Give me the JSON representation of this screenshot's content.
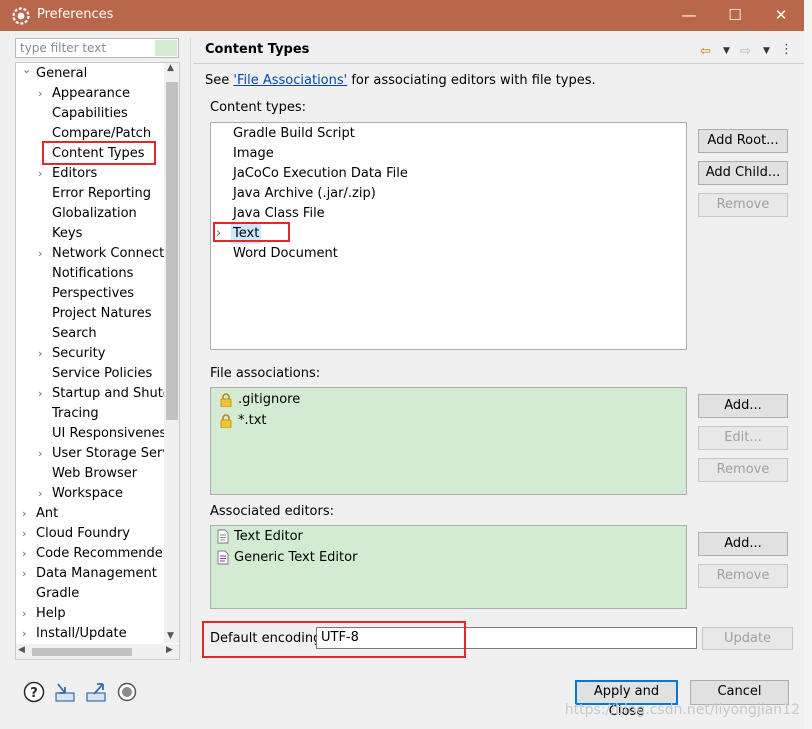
{
  "window": {
    "title": "Preferences",
    "minimize": "—",
    "maximize": "☐",
    "close": "✕"
  },
  "filter": {
    "placeholder": "type filter text"
  },
  "tree": {
    "items": [
      {
        "label": "General",
        "level": 0,
        "expanded": true
      },
      {
        "label": "Appearance",
        "level": 1,
        "arrow": true
      },
      {
        "label": "Capabilities",
        "level": 1
      },
      {
        "label": "Compare/Patch",
        "level": 1
      },
      {
        "label": "Content Types",
        "level": 1,
        "selected": true
      },
      {
        "label": "Editors",
        "level": 1,
        "arrow": true
      },
      {
        "label": "Error Reporting",
        "level": 1
      },
      {
        "label": "Globalization",
        "level": 1
      },
      {
        "label": "Keys",
        "level": 1
      },
      {
        "label": "Network Connectio",
        "level": 1,
        "arrow": true
      },
      {
        "label": "Notifications",
        "level": 1
      },
      {
        "label": "Perspectives",
        "level": 1
      },
      {
        "label": "Project Natures",
        "level": 1
      },
      {
        "label": "Search",
        "level": 1
      },
      {
        "label": "Security",
        "level": 1,
        "arrow": true
      },
      {
        "label": "Service Policies",
        "level": 1
      },
      {
        "label": "Startup and Shutdo",
        "level": 1,
        "arrow": true
      },
      {
        "label": "Tracing",
        "level": 1
      },
      {
        "label": "UI Responsiveness",
        "level": 1
      },
      {
        "label": "User Storage Servic",
        "level": 1,
        "arrow": true
      },
      {
        "label": "Web Browser",
        "level": 1
      },
      {
        "label": "Workspace",
        "level": 1,
        "arrow": true
      },
      {
        "label": "Ant",
        "level": 0,
        "arrow": true
      },
      {
        "label": "Cloud Foundry",
        "level": 0,
        "arrow": true
      },
      {
        "label": "Code Recommenders",
        "level": 0,
        "arrow": true
      },
      {
        "label": "Data Management",
        "level": 0,
        "arrow": true
      },
      {
        "label": "Gradle",
        "level": 0
      },
      {
        "label": "Help",
        "level": 0,
        "arrow": true
      },
      {
        "label": "Install/Update",
        "level": 0,
        "arrow": true
      }
    ]
  },
  "panel": {
    "title": "Content Types",
    "see_prefix": "See ",
    "see_link": "'File Associations'",
    "see_suffix": " for associating editors with file types.",
    "content_types_label": "Content types:",
    "content_types": [
      "Gradle Build Script",
      "Image",
      "JaCoCo Execution Data File",
      "Java Archive (.jar/.zip)",
      "Java Class File",
      "Text",
      "Word Document"
    ],
    "file_assoc_label": "File associations:",
    "file_assoc": [
      ".gitignore",
      "*.txt"
    ],
    "assoc_editors_label": "Associated editors:",
    "assoc_editors": [
      "Text Editor",
      "Generic Text Editor"
    ],
    "encoding_label": "Default encoding:",
    "encoding_value": "UTF-8"
  },
  "buttons": {
    "add_root": "Add Root...",
    "add_child": "Add Child...",
    "remove": "Remove",
    "add": "Add...",
    "edit": "Edit...",
    "update": "Update",
    "apply_close": "Apply and Close",
    "cancel": "Cancel"
  },
  "watermark": "https://blog.csdn.net/liyongjian12"
}
